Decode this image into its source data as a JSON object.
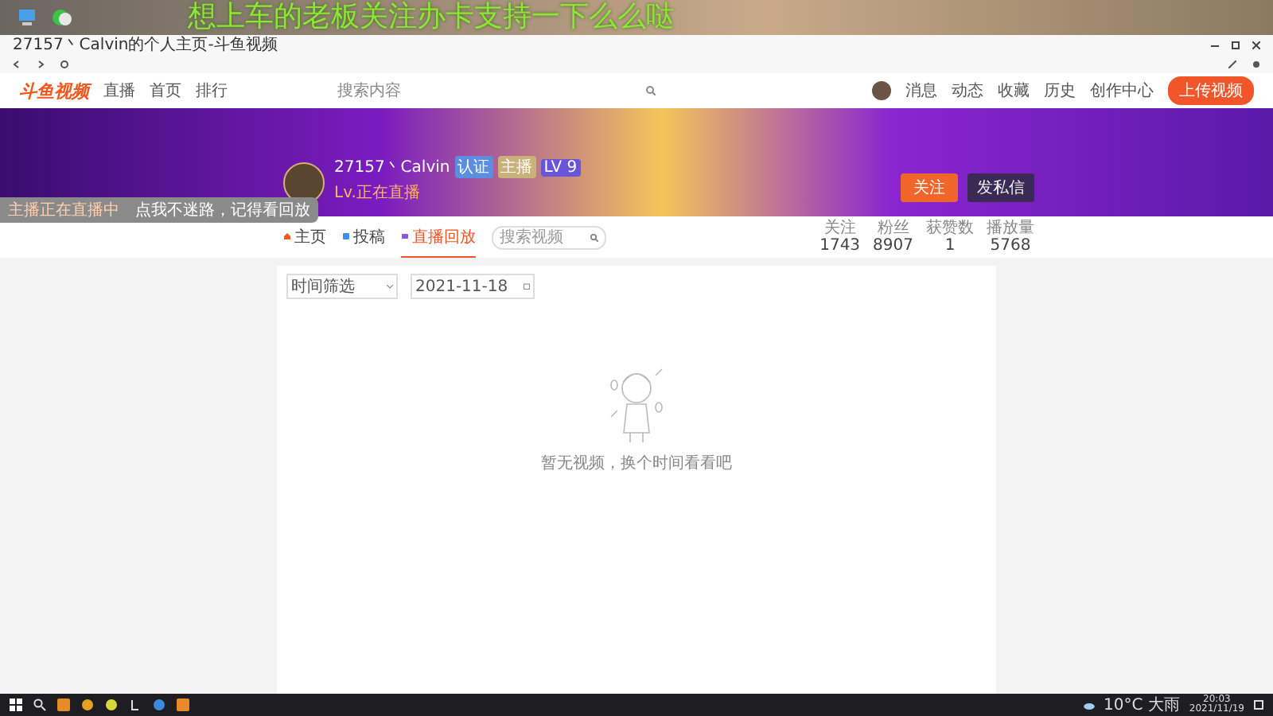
{
  "overlay_text": "想上车的老板关注办卡支持一下么么哒",
  "window": {
    "title": "27157丶Calvin的个人主页-斗鱼视频"
  },
  "site_nav": {
    "logo": "斗鱼视频",
    "links": [
      "直播",
      "首页",
      "排行"
    ],
    "search_placeholder": "搜索内容",
    "user_links": [
      "消息",
      "动态",
      "收藏",
      "历史",
      "创作中心"
    ],
    "upload_button": "上传视频"
  },
  "profile": {
    "name": "27157丶Calvin",
    "badges": [
      "认证",
      "主播",
      "LV 9"
    ],
    "subtitle": "Lv.正在直播",
    "follow_button": "关注",
    "message_button": "发私信",
    "stats": [
      {
        "label": "关注",
        "value": "1743"
      },
      {
        "label": "粉丝",
        "value": "8907"
      },
      {
        "label": "获赞数",
        "value": "1"
      },
      {
        "label": "播放量",
        "value": "5768"
      }
    ]
  },
  "toast": {
    "title": "主播正在直播中",
    "text": "点我不迷路，记得看回放"
  },
  "tabs": [
    {
      "label": "主页",
      "selected": false,
      "kind": "home"
    },
    {
      "label": "投稿",
      "selected": false,
      "kind": "video"
    },
    {
      "label": "直播回放",
      "selected": true,
      "kind": "replay"
    }
  ],
  "tab_search_placeholder": "搜索视频",
  "filters": {
    "time_filter": "时间筛选",
    "date": "2021-11-18"
  },
  "empty_message": "暂无视频，换个时间看看吧",
  "taskbar": {
    "weather": "10°C 大雨",
    "time": "20:03",
    "date": "2021/11/19"
  }
}
